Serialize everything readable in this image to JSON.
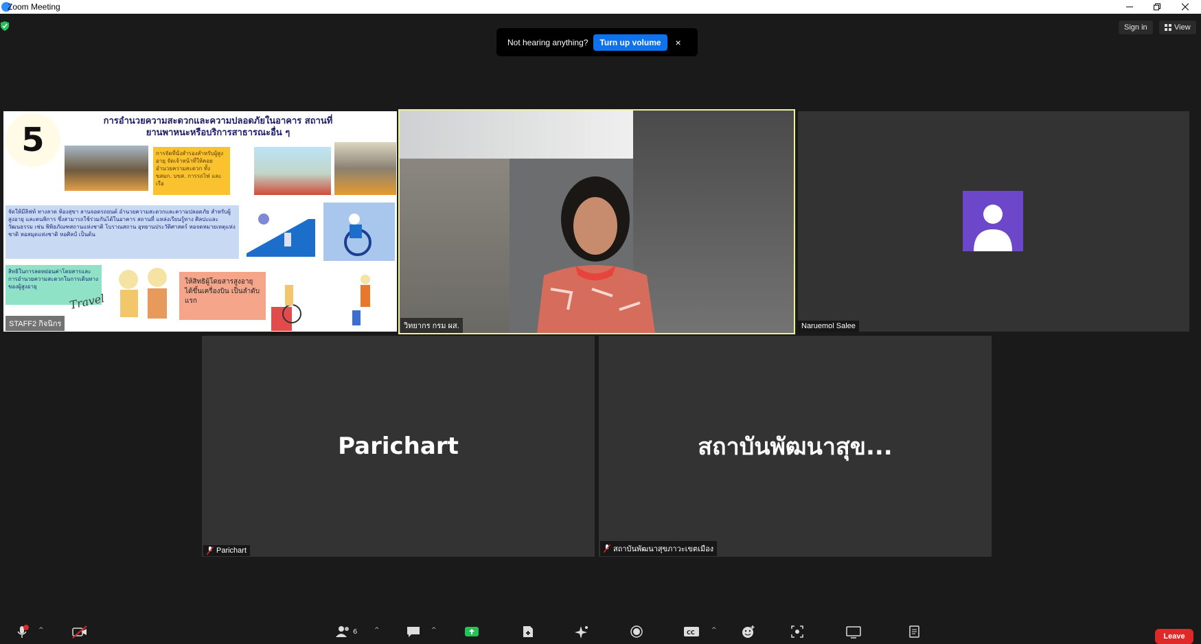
{
  "window": {
    "title": "Zoom Meeting",
    "controls": [
      "minimize-icon",
      "restore-icon",
      "close-icon"
    ]
  },
  "header": {
    "sign_in": "Sign in",
    "view": "View"
  },
  "toast": {
    "message": "Not hearing anything?",
    "button": "Turn up volume",
    "close": "×"
  },
  "tiles": [
    {
      "id": "slide",
      "name": "STAFF2 กิจนิกร",
      "type": "screen-share"
    },
    {
      "id": "speaker",
      "name": "วิทยากร กรม ผส.",
      "type": "video",
      "active_speaker": true
    },
    {
      "id": "naruemol",
      "name": "Naruemol Salee",
      "type": "avatar"
    },
    {
      "id": "parichart",
      "name": "Parichart",
      "display_name": "Parichart",
      "muted": true
    },
    {
      "id": "institute",
      "name": "สถาบันพัฒนาสุขภาวะเขตเมือง",
      "display_name": "สถาบันพัฒนาสุข...",
      "muted": true
    }
  ],
  "slide": {
    "number": "5",
    "title_line1": "การอำนวยความสะดวกและความปลอดภัยในอาคาร สถานที่",
    "title_line2": "ยานพาหนะหรือบริการสาธารณะอื่น ๆ",
    "box1": "การจัดที่นั่งสำรองสำหรับผู้สูงอายุ จัดเจ้าหน้าที่ให้คอยอำนวยความสะดวก ทั้ง ขสมก. บขส. การรถไฟ และเรือ",
    "box2": "จัดให้มีลิฟท์ ทางลาด ห้องสุขา ลานจอดรถยนต์ อำนวยความสะดวกและความปลอดภัย สำหรับผู้สูงอายุ และคนพิการ ซึ่งสามารถใช้ร่วมกันได้ในอาคาร สถานที่ แหล่งเรียนรู้ทาง ศิลปะและวัฒนธรรม เช่น พิพิธภัณฑสถานแห่งชาติ โบราณสถาน อุทยานประวัติศาสตร์ หอจดหมายเหตุแห่งชาติ หอสมุดแห่งชาติ หอศิลป์ เป็นต้น",
    "box3": "สิทธิในการลดหย่อนค่าโดยสารและ การอำนวยความสะดวกในการเดินทาง ของผู้สูงอายุ",
    "box4": "ให้สิทธิผู้โดยสารสูงอายุ ได้ขึ้นเครื่องบิน เป็นลำดับแรก",
    "travel": "Travel"
  },
  "toolbar": {
    "participants_count": "6",
    "leave": "Leave",
    "icons": [
      "microphone-icon",
      "video-off-icon",
      "participants-icon",
      "chat-icon",
      "share-screen-icon",
      "apps-icon",
      "ai-companion-icon",
      "record-icon",
      "captions-icon",
      "reactions-icon",
      "immersive-icon",
      "whiteboard-icon",
      "notes-icon"
    ]
  },
  "colors": {
    "accent": "#0e72ed",
    "leave": "#e02828",
    "speaker_border": "#eeef9a",
    "avatar": "#6c47c9",
    "tile_bg": "#333333"
  }
}
